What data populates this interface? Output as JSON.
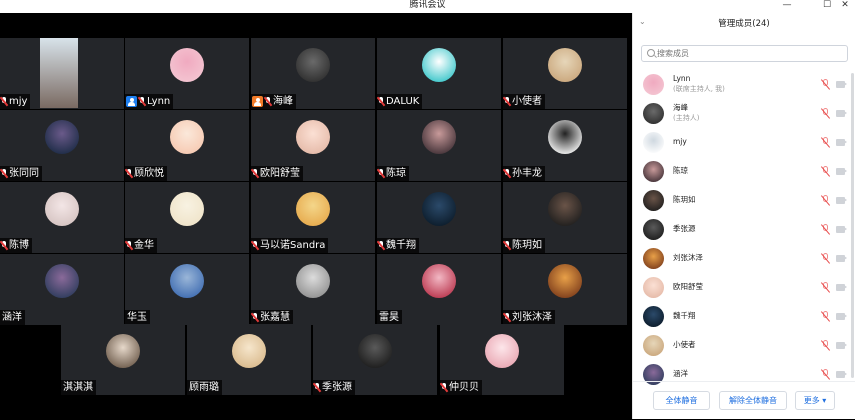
{
  "window": {
    "title": "腾讯会议",
    "minimize": "—",
    "maximize": "☐",
    "close": "✕"
  },
  "participants_grid": [
    {
      "name": "mjy",
      "avatar": "photo-window",
      "colors": [
        "#7a6a62",
        "#d8e3ea"
      ],
      "muted": true
    },
    {
      "name": "Lynn",
      "avatar": "cartoon-pig",
      "colors": [
        "#f4c6d2",
        "#f0aac0"
      ],
      "muted": true,
      "host_badge": "#1e7ff0"
    },
    {
      "name": "海峰",
      "avatar": "person-dark",
      "colors": [
        "#2c2c2c",
        "#6a6a6a"
      ],
      "muted": true,
      "host_badge": "#f07a28"
    },
    {
      "name": "DALUK",
      "avatar": "cow-cartoon",
      "colors": [
        "#34c4c8",
        "#ffffff"
      ],
      "muted": true
    },
    {
      "name": "小使者",
      "avatar": "cat-glasses",
      "colors": [
        "#c9a57a",
        "#e6d6b9"
      ],
      "muted": true
    },
    {
      "name": "张同同",
      "avatar": "anime-girl",
      "colors": [
        "#1a2a44",
        "#6a5a8a"
      ],
      "muted": true
    },
    {
      "name": "顾欣悦",
      "avatar": "peach-light",
      "colors": [
        "#f6c8b0",
        "#fbe8da"
      ],
      "muted": true
    },
    {
      "name": "欧阳舒莹",
      "avatar": "girl-photo",
      "colors": [
        "#e4b8a6",
        "#fbe0d4"
      ],
      "muted": true
    },
    {
      "name": "陈琼",
      "avatar": "girl-dark",
      "colors": [
        "#3e2e34",
        "#c89a9a"
      ],
      "muted": true
    },
    {
      "name": "孙丰龙",
      "avatar": "calligraphy",
      "colors": [
        "#ffffff",
        "#222222"
      ],
      "muted": true
    },
    {
      "name": "陈博",
      "avatar": "couple-photo",
      "colors": [
        "#d4c2c0",
        "#f3e6e6"
      ],
      "muted": true
    },
    {
      "name": "金华",
      "avatar": "cream",
      "colors": [
        "#efe3c8",
        "#f8f2e2"
      ],
      "muted": true
    },
    {
      "name": "马以诺Sandra",
      "avatar": "yellow-girl",
      "colors": [
        "#e6a84a",
        "#f4d68a"
      ],
      "muted": true
    },
    {
      "name": "魏千翔",
      "avatar": "dark-sea",
      "colors": [
        "#0b1a28",
        "#2b4a6a"
      ],
      "muted": true
    },
    {
      "name": "陈玥如",
      "avatar": "dark-portrait",
      "colors": [
        "#1c1c1c",
        "#6a5448"
      ],
      "muted": true
    },
    {
      "name": "涵洋",
      "avatar": "city-night",
      "colors": [
        "#2a3a5a",
        "#8a6a9a"
      ],
      "muted": false
    },
    {
      "name": "华玉",
      "avatar": "seaside",
      "colors": [
        "#3c6ab0",
        "#9ab6d8"
      ],
      "muted": false
    },
    {
      "name": "张嘉慧",
      "avatar": "silhouette",
      "colors": [
        "#8e8e8e",
        "#dcdcdc"
      ],
      "muted": true
    },
    {
      "name": "雷昊",
      "avatar": "red-girl",
      "colors": [
        "#b8324a",
        "#f2b8c4"
      ],
      "muted": false
    },
    {
      "name": "刘张沐泽",
      "avatar": "anime-boy",
      "colors": [
        "#7a3a1a",
        "#e8a048"
      ],
      "muted": true
    },
    {
      "name": "淇淇淇",
      "avatar": "woman-photo",
      "colors": [
        "#6a5848",
        "#e6d8ca"
      ],
      "muted": false
    },
    {
      "name": "顾雨璐",
      "avatar": "dog-photo",
      "colors": [
        "#d8b88a",
        "#f6e6cc"
      ],
      "muted": false
    },
    {
      "name": "季张源",
      "avatar": "person-shadow",
      "colors": [
        "#1a1a1a",
        "#5a5a5a"
      ],
      "muted": true
    },
    {
      "name": "仲贝贝",
      "avatar": "pink-photo",
      "colors": [
        "#e8a4b0",
        "#fde6ea"
      ],
      "muted": true
    }
  ],
  "panel": {
    "title": "管理成员(24)",
    "search_placeholder": "搜索成员",
    "members": [
      {
        "name": "Lynn",
        "role": "(联席主持人, 我)",
        "colors": [
          "#f4c6d2",
          "#f0aac0"
        ]
      },
      {
        "name": "海峰",
        "role": "(主持人)",
        "colors": [
          "#2c2c2c",
          "#6a6a6a"
        ]
      },
      {
        "name": "mjy",
        "role": "",
        "colors": [
          "#ffffff",
          "#cfd8e0"
        ]
      },
      {
        "name": "陈琼",
        "role": "",
        "colors": [
          "#3e2e34",
          "#c89a9a"
        ]
      },
      {
        "name": "陈玥如",
        "role": "",
        "colors": [
          "#1c1c1c",
          "#6a5448"
        ]
      },
      {
        "name": "季张源",
        "role": "",
        "colors": [
          "#1a1a1a",
          "#5a5a5a"
        ]
      },
      {
        "name": "刘张沐泽",
        "role": "",
        "colors": [
          "#7a3a1a",
          "#e8a048"
        ]
      },
      {
        "name": "欧阳舒莹",
        "role": "",
        "colors": [
          "#e4b8a6",
          "#fbe0d4"
        ]
      },
      {
        "name": "魏千翔",
        "role": "",
        "colors": [
          "#0b1a28",
          "#2b4a6a"
        ]
      },
      {
        "name": "小使者",
        "role": "",
        "colors": [
          "#c9a57a",
          "#e6d6b9"
        ]
      },
      {
        "name": "涵洋",
        "role": "",
        "colors": [
          "#2a3a5a",
          "#8a6a9a"
        ]
      }
    ],
    "buttons": {
      "mute_all": "全体静音",
      "unmute_all": "解除全体静音",
      "more": "更多 ▾"
    }
  },
  "accent": "#1f6fe0"
}
